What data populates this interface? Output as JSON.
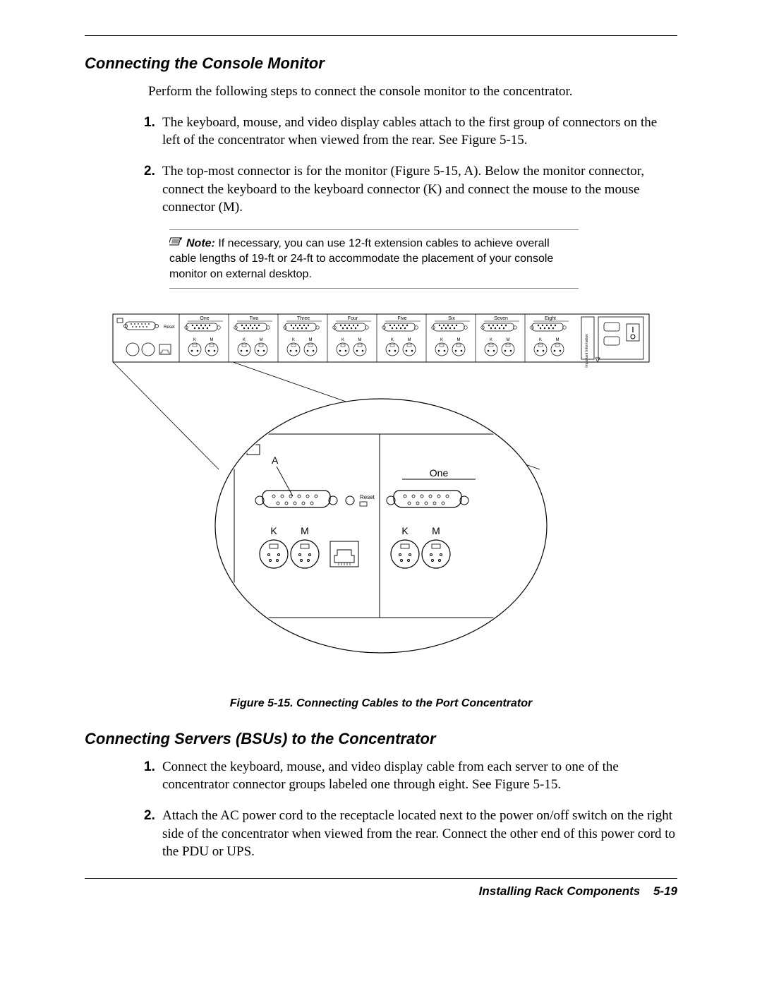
{
  "section1": {
    "heading": "Connecting the Console Monitor",
    "intro": "Perform the following steps to connect the console monitor to the concentrator.",
    "steps": [
      {
        "num": "1.",
        "text": "The keyboard, mouse, and video display cables attach to the first group of connectors on the left of the concentrator when viewed from the rear. See Figure 5-15."
      },
      {
        "num": "2.",
        "text": "The top-most connector is for the monitor (Figure 5-15, A). Below the monitor connector, connect the keyboard to the keyboard connector (K) and connect the mouse to the mouse connector (M)."
      }
    ],
    "note_label": "Note:",
    "note_text": " If necessary, you can use 12-ft extension cables to achieve overall cable lengths of 19-ft or 24-ft to accommodate the placement of your console monitor on external desktop."
  },
  "figure": {
    "caption": "Figure 5-15. Connecting Cables to the Port Concentrator",
    "ports": [
      "One",
      "Two",
      "Three",
      "Four",
      "Five",
      "Six",
      "Seven",
      "Eight"
    ],
    "km": {
      "k": "K",
      "m": "M"
    },
    "important": "Important Information",
    "callout_a": "A",
    "zoom_port": "One",
    "reset": "Reset"
  },
  "section2": {
    "heading": "Connecting Servers (BSUs) to the Concentrator",
    "steps": [
      {
        "num": "1.",
        "text": "Connect the keyboard, mouse, and video display cable from each server to one of the concentrator connector groups labeled one through eight. See Figure 5-15."
      },
      {
        "num": "2.",
        "text": "Attach the AC power cord to the receptacle located next to the power on/off switch on the right side of the concentrator when viewed from the rear. Connect the other end of this power cord to the PDU or UPS."
      }
    ]
  },
  "footer": {
    "title": "Installing Rack Components",
    "page": "5-19"
  }
}
